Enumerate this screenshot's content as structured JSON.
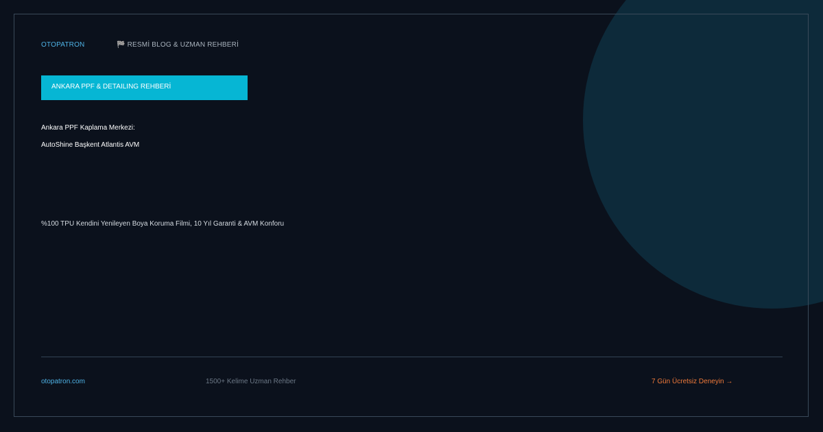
{
  "header": {
    "brand": "OTOPATRON",
    "tagline": "🏁 RESMİ BLOG & UZMAN REHBERİ"
  },
  "badge": {
    "label": "ANKARA PPF & DETAILING REHBERİ"
  },
  "main": {
    "title_line_1": "Ankara PPF Kaplama Merkezi:",
    "title_line_2": "AutoShine Başkent Atlantis AVM",
    "subtitle": "%100 TPU Kendini Yenileyen Boya Koruma Filmi, 10 Yıl Garanti & AVM Konforu"
  },
  "footer": {
    "url": "otopatron.com",
    "stat": "1500+ Kelime Uzman Rehber",
    "cta": "7 Gün Ücretsiz Deneyin →"
  },
  "colors": {
    "background": "#0b111c",
    "accent": "#06b6d4",
    "brand": "#4fb3e6",
    "cta": "#f07a3a",
    "decoration": "#0d2a3a"
  }
}
